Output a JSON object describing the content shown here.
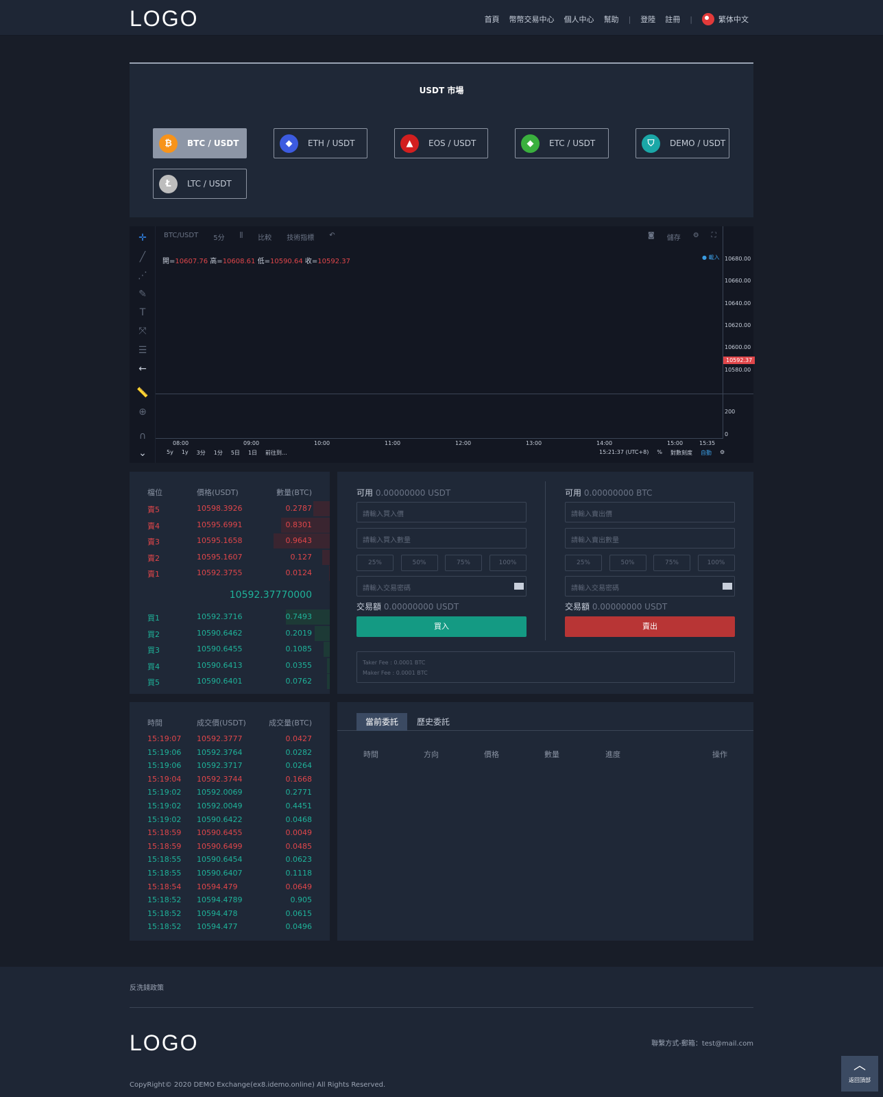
{
  "header": {
    "logo": "LOGO",
    "nav": [
      "首頁",
      "幣幣交易中心",
      "個人中心",
      "幫助",
      "|",
      "登陸",
      "註冊",
      "|"
    ],
    "lang": "繁体中文"
  },
  "market": {
    "title": "USDT 市場",
    "pairs": [
      {
        "label": "BTC / USDT",
        "icon": "bitcoin-icon",
        "color": "#f7931a",
        "glyph": "₿",
        "active": true
      },
      {
        "label": "ETH / USDT",
        "icon": "ethereum-icon",
        "color": "#3c5be0",
        "glyph": "◆",
        "active": false
      },
      {
        "label": "EOS / USDT",
        "icon": "eos-icon",
        "color": "#d21f1f",
        "glyph": "▲",
        "active": false
      },
      {
        "label": "ETC / USDT",
        "icon": "etc-icon",
        "color": "#3ab03e",
        "glyph": "◆",
        "active": false
      },
      {
        "label": "DEMO / USDT",
        "icon": "demo-shield-icon",
        "color": "#1aa7a7",
        "glyph": "⛉",
        "active": false
      },
      {
        "label": "LTC / USDT",
        "icon": "litecoin-icon",
        "color": "#bdbdbd",
        "glyph": "Ł",
        "active": false
      }
    ]
  },
  "chart": {
    "symbol": "BTC/USDT",
    "interval": "5分",
    "compare": "比較",
    "indicators": "技術指標",
    "save": "儲存",
    "ohlc": {
      "open_label": "開=",
      "open": "10607.76",
      "high_label": "高=",
      "high": "10608.61",
      "low_label": "低=",
      "low": "10590.64",
      "close_label": "收=",
      "close": "10592.37"
    },
    "loading": "● 載入",
    "price_tag": "10592.37",
    "y_ticks": [
      "10680.00",
      "10660.00",
      "10640.00",
      "10620.00",
      "10600.00",
      "10580.00"
    ],
    "vol_ticks": [
      "200",
      "0"
    ],
    "x_ticks": [
      "08:00",
      "09:00",
      "10:00",
      "11:00",
      "12:00",
      "13:00",
      "14:00",
      "15:00",
      "15:35"
    ],
    "ranges": [
      "5y",
      "1y",
      "3分",
      "1分",
      "5日",
      "1日",
      "前往到..."
    ],
    "clock": "15:21:37 (UTC+8)",
    "pct": "%",
    "log": "對數刻度",
    "auto": "自動"
  },
  "orderbook": {
    "headers": [
      "檔位",
      "價格(USDT)",
      "數量(BTC)"
    ],
    "asks": [
      {
        "level": "賣5",
        "price": "10598.3926",
        "qty": "0.2787",
        "depth": 0.28
      },
      {
        "level": "賣4",
        "price": "10595.6991",
        "qty": "0.8301",
        "depth": 0.83
      },
      {
        "level": "賣3",
        "price": "10595.1658",
        "qty": "0.9643",
        "depth": 0.96
      },
      {
        "level": "賣2",
        "price": "10595.1607",
        "qty": "0.127",
        "depth": 0.13
      },
      {
        "level": "賣1",
        "price": "10592.3755",
        "qty": "0.0124",
        "depth": 0.01
      }
    ],
    "last": "10592.37770000",
    "bids": [
      {
        "level": "買1",
        "price": "10592.3716",
        "qty": "0.7493",
        "depth": 0.75
      },
      {
        "level": "買2",
        "price": "10590.6462",
        "qty": "0.2019",
        "depth": 0.26
      },
      {
        "level": "買3",
        "price": "10590.6455",
        "qty": "0.1085",
        "depth": 0.1
      },
      {
        "level": "買4",
        "price": "10590.6413",
        "qty": "0.0355",
        "depth": 0.05
      },
      {
        "level": "買5",
        "price": "10590.6401",
        "qty": "0.0762",
        "depth": 0.05
      }
    ]
  },
  "buy": {
    "avail_label": "可用",
    "avail": "0.00000000 USDT",
    "price_ph": "請輸入買入價",
    "qty_ph": "請輸入買入數量",
    "pwd_ph": "請輸入交易密碼",
    "amount_label": "交易額",
    "amount": "0.00000000 USDT",
    "btn": "買入"
  },
  "sell": {
    "avail_label": "可用",
    "avail": "0.00000000 BTC",
    "price_ph": "請輸入賣出價",
    "qty_ph": "請輸入賣出數量",
    "pwd_ph": "請輸入交易密碼",
    "amount_label": "交易額",
    "amount": "0.00000000 USDT",
    "btn": "賣出"
  },
  "pcts": [
    "25%",
    "50%",
    "75%",
    "100%"
  ],
  "fees": {
    "taker": "Taker Fee : 0.0001 BTC",
    "maker": "Maker Fee : 0.0001 BTC"
  },
  "trades": {
    "headers": [
      "時間",
      "成交價(USDT)",
      "成交量(BTC)"
    ],
    "rows": [
      {
        "t": "15:19:07",
        "p": "10592.3777",
        "q": "0.0427",
        "side": "sell"
      },
      {
        "t": "15:19:06",
        "p": "10592.3764",
        "q": "0.0282",
        "side": "buy"
      },
      {
        "t": "15:19:06",
        "p": "10592.3717",
        "q": "0.0264",
        "side": "buy"
      },
      {
        "t": "15:19:04",
        "p": "10592.3744",
        "q": "0.1668",
        "side": "sell"
      },
      {
        "t": "15:19:02",
        "p": "10592.0069",
        "q": "0.2771",
        "side": "buy"
      },
      {
        "t": "15:19:02",
        "p": "10592.0049",
        "q": "0.4451",
        "side": "buy"
      },
      {
        "t": "15:19:02",
        "p": "10590.6422",
        "q": "0.0468",
        "side": "buy"
      },
      {
        "t": "15:18:59",
        "p": "10590.6455",
        "q": "0.0049",
        "side": "sell"
      },
      {
        "t": "15:18:59",
        "p": "10590.6499",
        "q": "0.0485",
        "side": "sell"
      },
      {
        "t": "15:18:55",
        "p": "10590.6454",
        "q": "0.0623",
        "side": "buy"
      },
      {
        "t": "15:18:55",
        "p": "10590.6407",
        "q": "0.1118",
        "side": "buy"
      },
      {
        "t": "15:18:54",
        "p": "10594.479",
        "q": "0.0649",
        "side": "sell"
      },
      {
        "t": "15:18:52",
        "p": "10594.4789",
        "q": "0.905",
        "side": "buy"
      },
      {
        "t": "15:18:52",
        "p": "10594.478",
        "q": "0.0615",
        "side": "buy"
      },
      {
        "t": "15:18:52",
        "p": "10594.477",
        "q": "0.0496",
        "side": "buy"
      }
    ]
  },
  "orders": {
    "tabs": [
      "當前委託",
      "歷史委託"
    ],
    "headers": [
      "時間",
      "方向",
      "價格",
      "數量",
      "進度",
      "操作"
    ]
  },
  "footer": {
    "link": "反洗錢政策",
    "logo": "LOGO",
    "contact": "聯繫方式-郵箱：test@mail.com",
    "copyright": "CopyRight© 2020 DEMO Exchange(ex8.idemo.online) All Rights Reserved.",
    "back_top": "返回頂部"
  }
}
